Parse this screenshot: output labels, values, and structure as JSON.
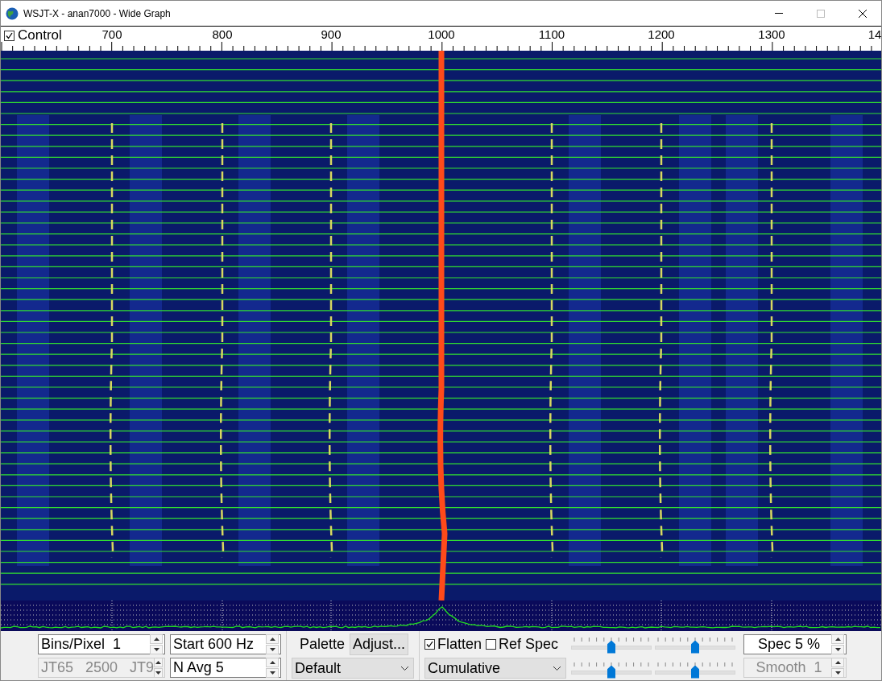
{
  "window": {
    "title": "WSJT-X - anan7000 - Wide Graph"
  },
  "scale": {
    "control": {
      "label": "Control",
      "checked": true
    },
    "labels": [
      "700",
      "800",
      "900",
      "1000",
      "1100",
      "1200",
      "1300",
      "14"
    ]
  },
  "controls": {
    "spin_left": [
      {
        "text": "Bins/Pixel  1",
        "disabled": false
      },
      {
        "text": "JT65   2500   JT9",
        "disabled": true
      }
    ],
    "spin_mid": [
      {
        "text": "Start 600 Hz",
        "disabled": false
      },
      {
        "text": "N Avg 5",
        "disabled": false
      }
    ],
    "palette_label": "Palette",
    "adjust_button": "Adjust...",
    "palette_select": "Default",
    "checks": [
      {
        "label": "Flatten",
        "checked": true
      },
      {
        "label": "Ref Spec",
        "checked": false
      }
    ],
    "spectrum_select": "Cumulative",
    "sliders": [
      {
        "level": 0.5
      },
      {
        "level": 0.5
      },
      {
        "level": 0.5
      },
      {
        "level": 0.5
      }
    ],
    "spin_right": [
      {
        "text": "Spec 5 %",
        "disabled": false
      },
      {
        "text": "Smooth  1",
        "disabled": true
      }
    ]
  }
}
